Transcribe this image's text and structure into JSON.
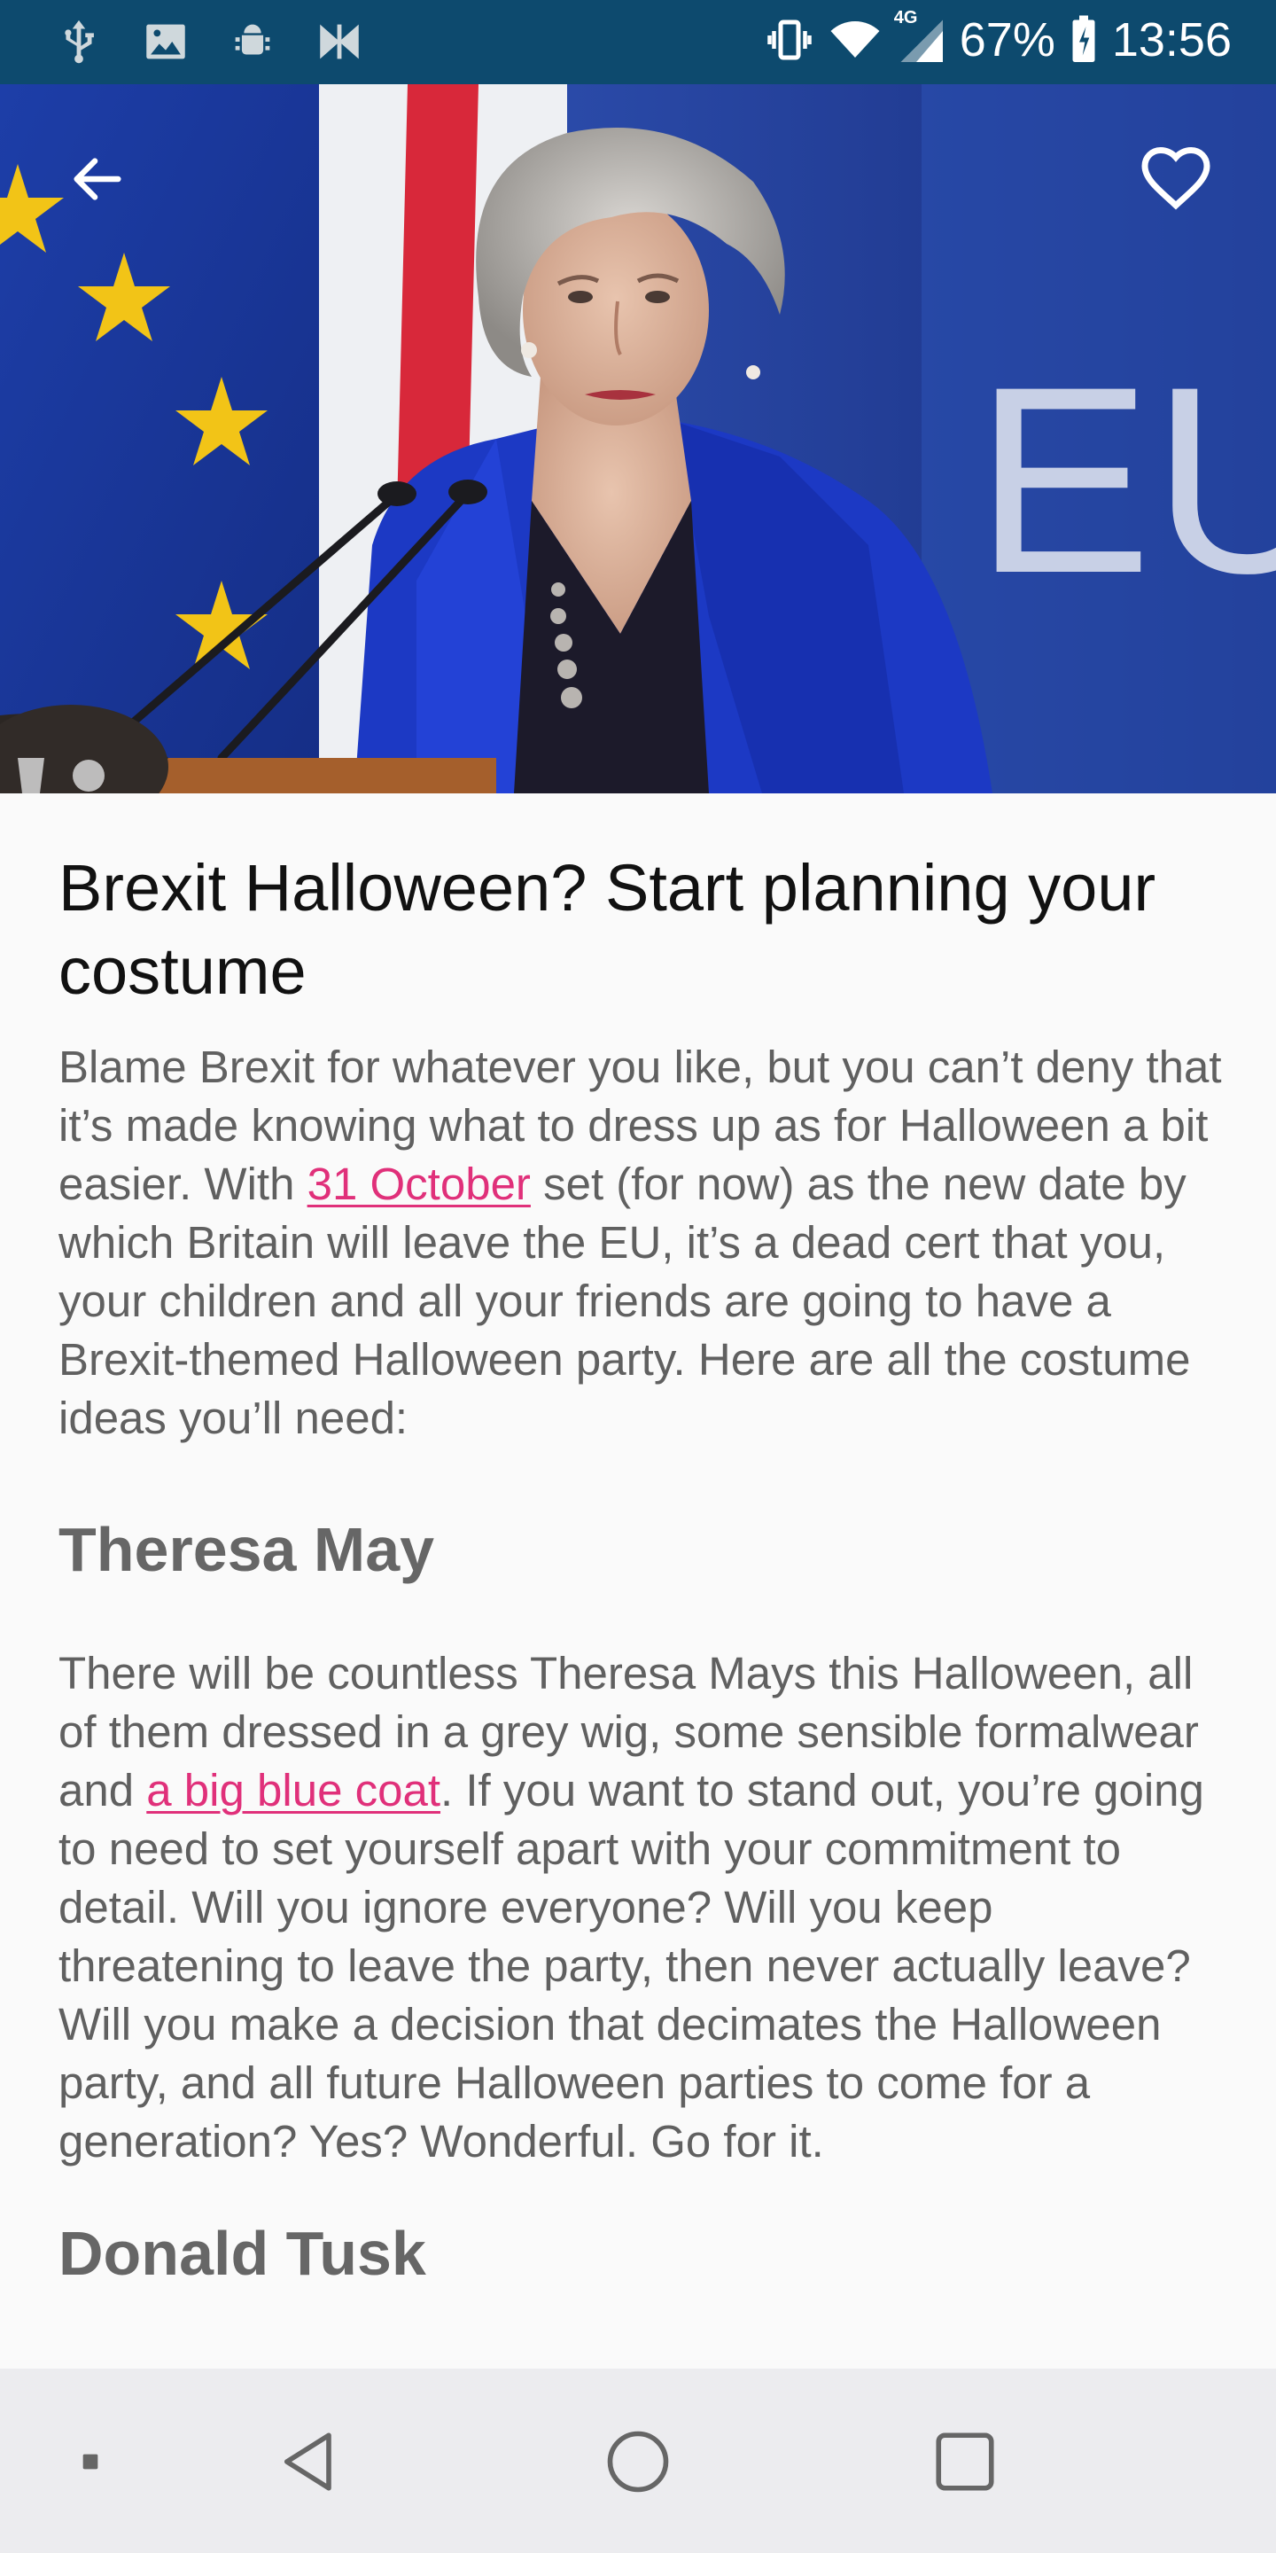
{
  "status_bar": {
    "left_icons": [
      "usb-icon",
      "image-icon",
      "android-debug-icon",
      "bowtie-app-icon"
    ],
    "network_label": "4G",
    "battery_percent": "67%",
    "time": "13:56",
    "background": "#0d4a6e"
  },
  "hero": {
    "back_icon": "arrow-left-icon",
    "favorite_icon": "heart-outline-icon",
    "backdrop_text": "EU"
  },
  "article": {
    "title": "Brexit Halloween? Start planning your costume",
    "intro": {
      "part1": "Blame Brexit for whatever you like, but you can’t deny that it’s made knowing what to dress up as for Halloween a bit easier. With ",
      "link": "31 October",
      "part2": " set (for now) as the new date by which Britain will leave the EU, it’s a dead cert that you, your children and all your friends are going to have a Brexit-themed Halloween party. Here are all the costume ideas you’ll need:"
    },
    "sections": [
      {
        "heading": "Theresa May",
        "body_part1": "There will be countless Theresa Mays this Halloween, all of them dressed in a grey wig, some sensible formalwear and ",
        "link": "a big blue coat",
        "body_part2": ". If you want to stand out, you’re going to need to set yourself apart with your commitment to detail. Will you ignore everyone? Will you keep threatening to leave the party, then never actually leave? Will you make a decision that decimates the Halloween party, and all future Halloween parties to come for a generation? Yes? Wonderful. Go for it."
      },
      {
        "heading": "Donald Tusk"
      }
    ],
    "link_color": "#e0307a"
  },
  "nav_bar": {
    "buttons": [
      "square-dot-icon",
      "back-triangle-icon",
      "home-circle-icon",
      "recents-square-icon"
    ]
  }
}
